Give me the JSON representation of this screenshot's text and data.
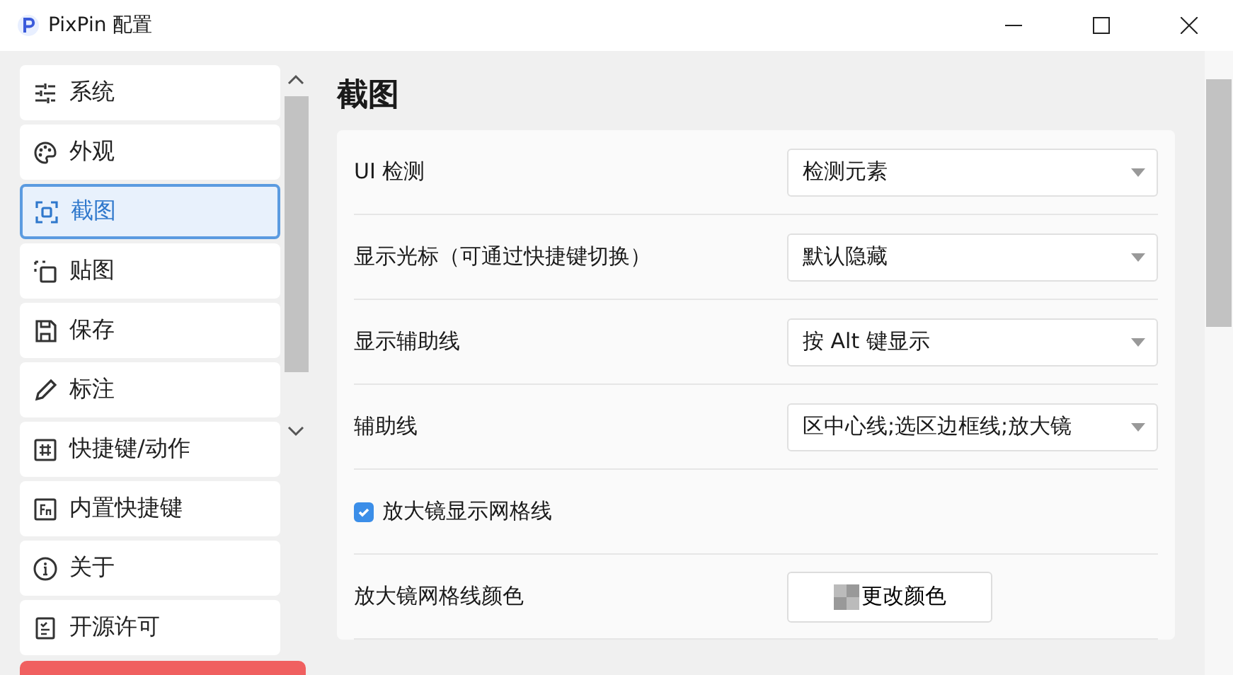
{
  "window": {
    "title": "PixPin 配置"
  },
  "sidebar": {
    "items": [
      {
        "label": "系统",
        "selected": false
      },
      {
        "label": "外观",
        "selected": false
      },
      {
        "label": "截图",
        "selected": true
      },
      {
        "label": "贴图",
        "selected": false
      },
      {
        "label": "保存",
        "selected": false
      },
      {
        "label": "标注",
        "selected": false
      },
      {
        "label": "快捷键/动作",
        "selected": false
      },
      {
        "label": "内置快捷键",
        "selected": false
      },
      {
        "label": "关于",
        "selected": false
      },
      {
        "label": "开源许可",
        "selected": false
      }
    ]
  },
  "page": {
    "title": "截图",
    "rows": [
      {
        "kind": "select",
        "label": "UI 检测",
        "value": "检测元素"
      },
      {
        "kind": "select",
        "label": "显示光标（可通过快捷键切换）",
        "value": "默认隐藏"
      },
      {
        "kind": "select",
        "label": "显示辅助线",
        "value": "按 Alt 键显示"
      },
      {
        "kind": "select",
        "label": "辅助线",
        "value": "区中心线;选区边框线;放大镜"
      },
      {
        "kind": "checkbox",
        "label": "放大镜显示网格线",
        "checked": true
      },
      {
        "kind": "color",
        "label": "放大镜网格线颜色",
        "button": "更改颜色"
      }
    ]
  }
}
